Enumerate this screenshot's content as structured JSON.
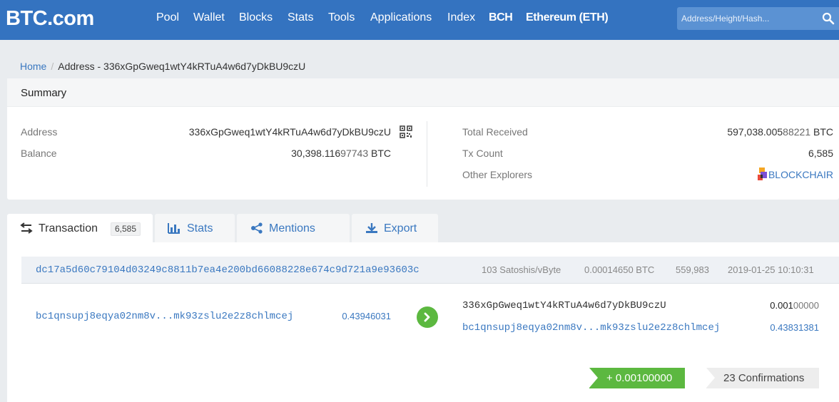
{
  "header": {
    "logo": "BTC.com",
    "nav": [
      "Pool",
      "Wallet",
      "Blocks",
      "Stats",
      "Tools",
      "Applications",
      "Index",
      "BCH",
      "Ethereum (ETH)"
    ],
    "search_placeholder": "Address/Height/Hash..."
  },
  "breadcrumb": {
    "home": "Home",
    "separator": "/",
    "current": "Address - 336xGpGweq1wtY4kRTuA4w6d7yDkBU9czU"
  },
  "summary": {
    "title": "Summary",
    "left": {
      "address_label": "Address",
      "address_value": "336xGpGweq1wtY4kRTuA4w6d7yDkBU9czU",
      "balance_label": "Balance",
      "balance_main": "30,398.116",
      "balance_tail": "97743",
      "balance_unit": " BTC"
    },
    "right": {
      "total_received_label": "Total Received",
      "total_received_main": "597,038.005",
      "total_received_tail": "88221",
      "total_received_unit": " BTC",
      "tx_count_label": "Tx Count",
      "tx_count_value": "6,585",
      "other_explorers_label": "Other Explorers",
      "explorer_link": "BLOCKCHAIR"
    }
  },
  "tabs": [
    {
      "label": "Transaction",
      "badge": "6,585",
      "icon": "swap-arrows-icon",
      "active": true
    },
    {
      "label": "Stats",
      "icon": "bar-chart-icon",
      "active": false
    },
    {
      "label": "Mentions",
      "icon": "share-icon",
      "active": false
    },
    {
      "label": "Export",
      "icon": "download-icon",
      "active": false
    }
  ],
  "transaction": {
    "hash": "dc17a5d60c79104d03249c8811b7ea4e200bd66088228e674c9d721a9e93603c",
    "fee_rate": "103 Satoshis/vByte",
    "fee": "0.00014650 BTC",
    "block_height": "559,983",
    "time": "2019-01-25 10:10:31",
    "inputs": [
      {
        "address": "bc1qnsupj8eqya02nm8v...mk93zslu2e2z8chlmcej",
        "amount": "0.43946031"
      }
    ],
    "outputs": [
      {
        "address": "336xGpGweq1wtY4kRTuA4w6d7yDkBU9czU",
        "amount_main": "0.001",
        "amount_tail": "00000",
        "is_self": true
      },
      {
        "address": "bc1qnsupj8eqya02nm8v...mk93zslu2e2z8chlmcej",
        "amount": "0.43831381",
        "is_self": false
      }
    ],
    "net_amount": "+ 0.00100000",
    "confirmations": "23 Confirmations"
  },
  "colors": {
    "header_blue": "#3473c0",
    "link_blue": "#3a78c0",
    "positive_green": "#5cb840"
  }
}
